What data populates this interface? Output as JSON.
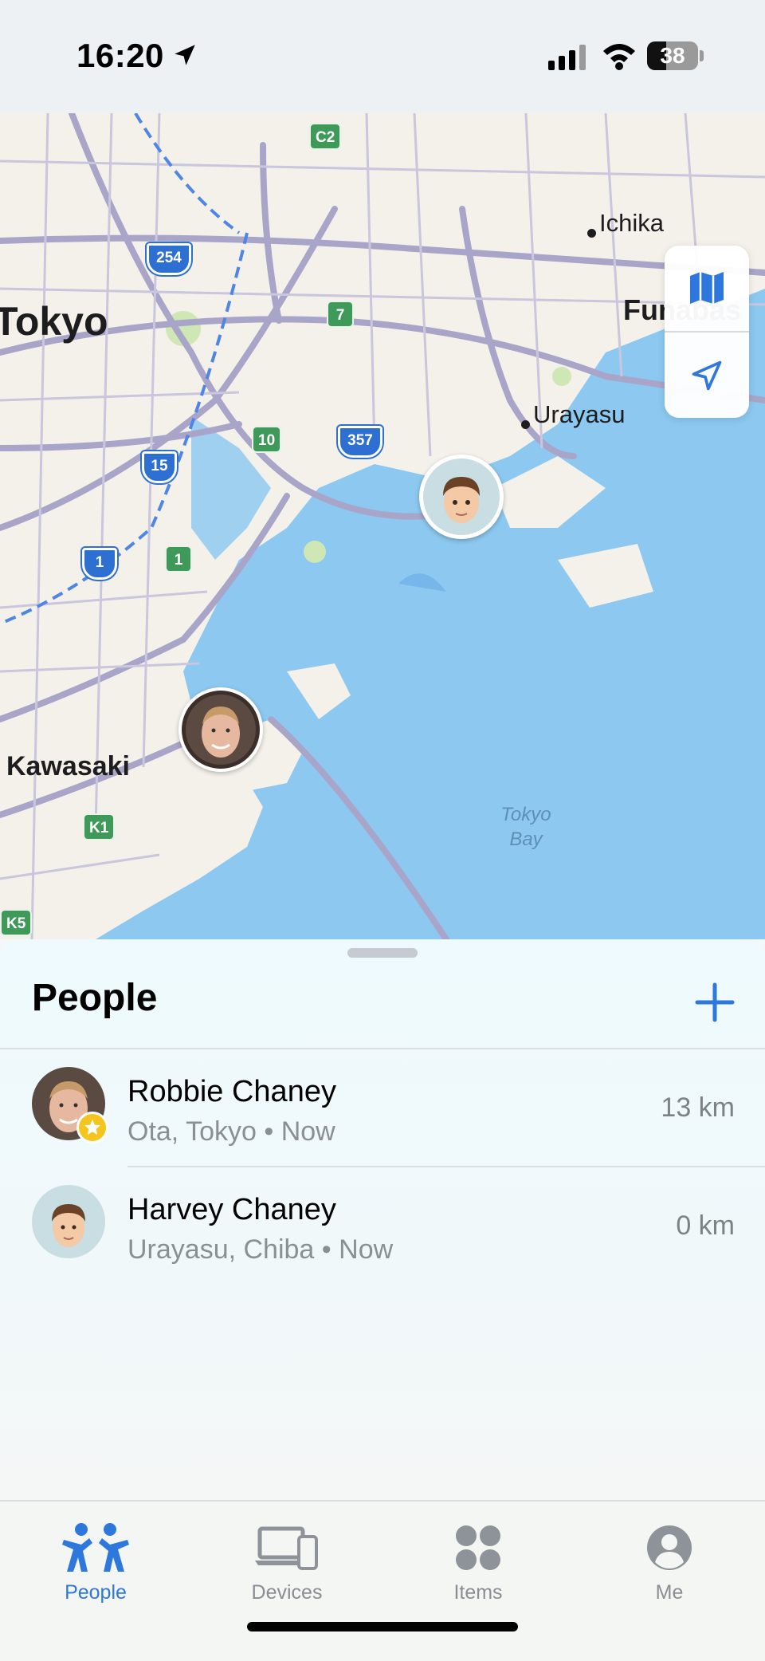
{
  "status_bar": {
    "time": "16:20",
    "battery": "38"
  },
  "map": {
    "cities": [
      {
        "label": "Tokyo"
      },
      {
        "label": "Kawasaki"
      },
      {
        "label": "Funabas"
      }
    ],
    "places": [
      {
        "label": "Urayasu"
      },
      {
        "label": "Ichika"
      }
    ],
    "water_label": [
      "Tokyo",
      "Bay"
    ],
    "expressway_shields": [
      "254",
      "15",
      "1",
      "357"
    ],
    "route_badges": [
      "C2",
      "7",
      "10",
      "1",
      "K1",
      "K5"
    ],
    "controls": {
      "map_icon": "map-icon",
      "location_icon": "location-arrow-icon"
    }
  },
  "people_sheet": {
    "title": "People",
    "add_icon": "plus-icon",
    "people": [
      {
        "name": "Robbie Chaney",
        "location": "Ota, Tokyo",
        "time": "Now",
        "distance": "13 km",
        "favorite": true
      },
      {
        "name": "Harvey Chaney",
        "location": "Urayasu, Chiba",
        "time": "Now",
        "distance": "0 km",
        "favorite": false
      }
    ]
  },
  "tabs": [
    {
      "label": "People",
      "icon": "people-icon",
      "active": true
    },
    {
      "label": "Devices",
      "icon": "devices-icon",
      "active": false
    },
    {
      "label": "Items",
      "icon": "items-icon",
      "active": false
    },
    {
      "label": "Me",
      "icon": "me-icon",
      "active": false
    }
  ],
  "colors": {
    "accent": "#2e77dc",
    "water": "#8cc8ef",
    "land": "#f4f1ea",
    "road": "#a9a5c9"
  }
}
